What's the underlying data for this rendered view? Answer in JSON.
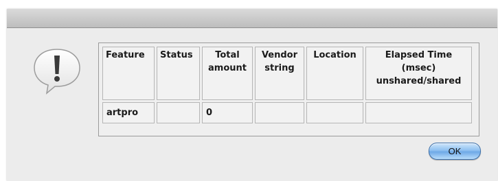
{
  "dialog": {
    "icon": "alert-exclamation-icon",
    "ok_label": "OK"
  },
  "table": {
    "headers": [
      "Feature",
      "Status",
      "Total\namount",
      "Vendor\nstring",
      "Location",
      "Elapsed Time\n(msec)\nunshared/shared"
    ],
    "rows": [
      [
        "artpro",
        "",
        "0",
        "",
        "",
        ""
      ]
    ]
  }
}
